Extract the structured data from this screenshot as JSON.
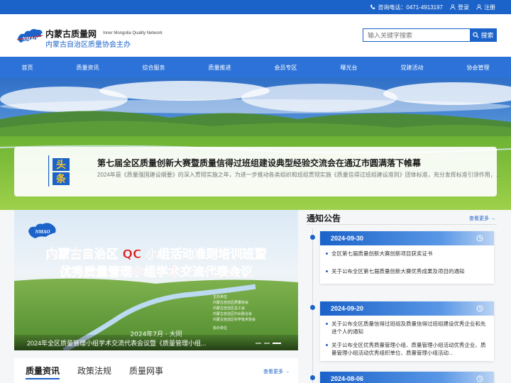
{
  "topbar": {
    "phone": "咨询电话：0471-4913197",
    "login": "登录",
    "register": "注册"
  },
  "header": {
    "logo_text": "NMAO",
    "title": "内蒙古质量网",
    "title_en": "Inner Mongolia Quality Network",
    "subtitle": "内蒙古自治区质量协会主办"
  },
  "search": {
    "placeholder": "输入关键字搜索",
    "button": "搜索"
  },
  "nav": {
    "items": [
      "首页",
      "质量资讯",
      "综合服务",
      "质量推进",
      "会员专区",
      "曝光台",
      "党建活动",
      "协会管理"
    ]
  },
  "headline": {
    "badge": "头条",
    "title": "第七届全区质量创新大赛暨质量信得过班组建设典型经验交流会在通辽市圆满落下帷幕",
    "summary": "2024年是《质量强国建设纲要》的深入贯彻实施之年，为进一步推动各类组织和班组贯彻实施《质量信得过班组建设准则》团体标准，充分发挥标准引领作用，引..."
  },
  "feature": {
    "logo_text": "NMAO",
    "line1": "内蒙古自治区 QC 小组活动准则培训班暨",
    "line2": "优秀质量管理小组学术交流代表会议",
    "date_text": "2024年7月 · 大同",
    "organizers": [
      "主办单位",
      "内蒙古自治区质量协会",
      "内蒙古自治区总工会",
      "内蒙古自治区妇女联合会",
      "内蒙古自治区科学技术协会"
    ],
    "organizer2": "协办单位",
    "caption": "2024年全区质量管理小组学术交流代表会议暨《质量管理小组..."
  },
  "news_tabs": {
    "tabs": [
      "质量资讯",
      "政策法规",
      "质量网事"
    ],
    "more": "查看更多 →"
  },
  "notice": {
    "title": "通知公告",
    "more": "查看更多 →",
    "groups": [
      {
        "date": "2024-09-30",
        "items": [
          "全区第七届质量创新大赛创新项目获奖证书",
          "关于公布全区第七届质量创新大赛优秀成果及项目的通知"
        ]
      },
      {
        "date": "2024-09-20",
        "items": [
          "关于公布全区质量信得过班组及质量信得过班组建设优秀企业和先进个人的通知",
          "关于公布全区优秀质量管理小组、质量管理小组活动优秀企业、质量管理小组活动优秀组织单位、质量管理小组活动..."
        ]
      },
      {
        "date": "2024-08-06",
        "items": []
      }
    ]
  },
  "colors": {
    "brand": "#1b62c9",
    "nav": "#2c72d8"
  }
}
